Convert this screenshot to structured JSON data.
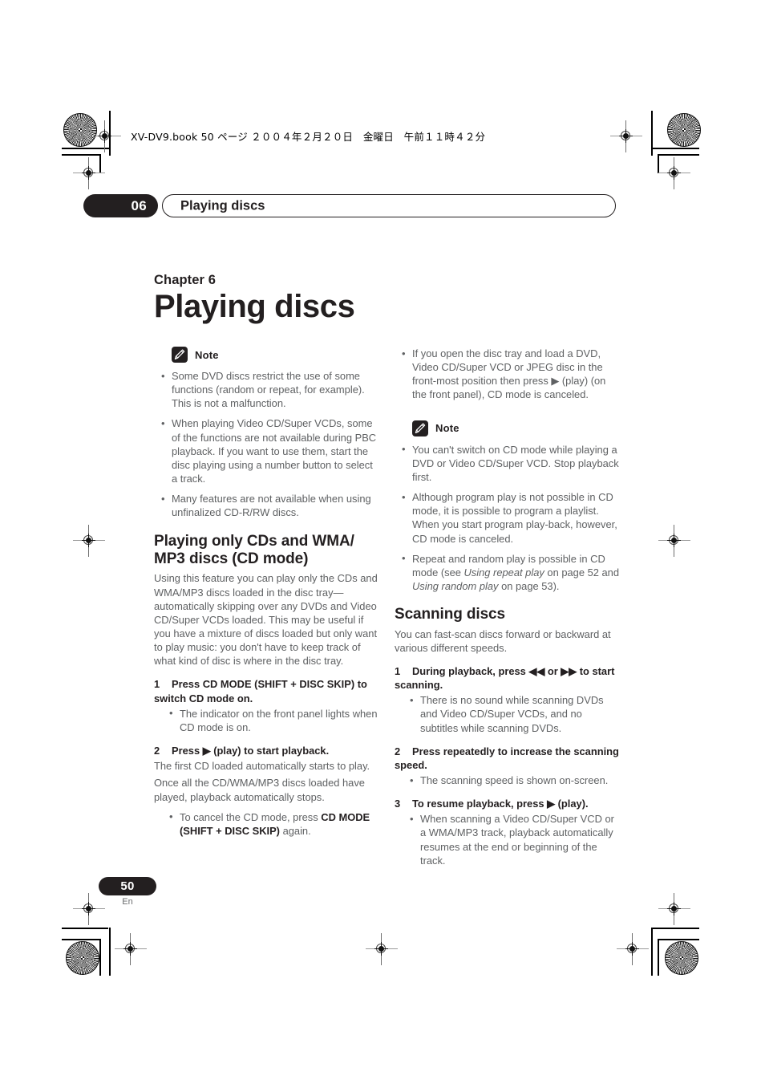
{
  "print_marks": {
    "book_stamp": "XV-DV9.book 50 ページ  ２００４年２月２０日　金曜日　午前１１時４２分"
  },
  "running_head": {
    "chapter_number": "06",
    "chapter_name": "Playing discs"
  },
  "title_block": {
    "chapter_label": "Chapter 6",
    "chapter_title": "Playing discs"
  },
  "left_column": {
    "note_label": "Note",
    "note_icon": "pencil-icon",
    "note_bullets": [
      "Some DVD discs restrict the use of some functions (random or repeat, for example). This is not a malfunction.",
      "When playing Video CD/Super VCDs, some of the functions are not available during PBC playback. If you want to use them, start the disc playing using a number button to select a track.",
      "Many features are not available when using unfinalized CD-R/RW discs."
    ],
    "section_heading": "Playing only CDs and WMA/ MP3 discs (CD mode)",
    "section_intro": "Using this feature you can play only the CDs and WMA/MP3 discs loaded in the disc tray—automatically skipping over any DVDs and Video CD/Super VCDs loaded. This may be useful if you have a mixture of discs loaded but only want to play music: you don't have to keep track of what kind of disc is where in the disc tray.",
    "step1_num": "1",
    "step1_text": "Press CD MODE (SHIFT + DISC SKIP) to switch CD mode on.",
    "step1_bullets": [
      "The indicator on the front panel lights when CD mode is on."
    ],
    "step2_num": "2",
    "step2_text": "Press ▶ (play) to start playback.",
    "step2_body_1": "The first CD loaded automatically starts to play.",
    "step2_body_2": "Once all the CD/WMA/MP3 discs loaded have played, playback automatically stops.",
    "step2_bullet_prefix": "To cancel the CD mode, press ",
    "step2_bullet_bold": "CD MODE (SHIFT + DISC SKIP)",
    "step2_bullet_suffix": " again."
  },
  "right_column": {
    "top_bullets": [
      "If you open the disc tray and load a DVD, Video CD/Super VCD or JPEG disc in the front-most position then press ▶ (play) (on the front panel), CD mode is canceled."
    ],
    "note_label": "Note",
    "note_icon": "pencil-icon",
    "note_bullet_1": "You can't switch on CD mode while playing a DVD or Video CD/Super VCD. Stop playback first.",
    "note_bullet_2": "Although program play is not possible in CD mode, it is possible to program a playlist. When you start program play-back, however, CD mode is canceled.",
    "note_bullet_3_pre": "Repeat and random play is possible in CD mode (see ",
    "note_bullet_3_it1": "Using repeat play",
    "note_bullet_3_mid": " on page 52 and ",
    "note_bullet_3_it2": "Using random play",
    "note_bullet_3_post": " on page 53).",
    "section_heading": "Scanning discs",
    "section_intro": "You can fast-scan discs forward or backward at various different speeds.",
    "step1_num": "1",
    "step1_text": "During playback, press ◀◀ or ▶▶ to start scanning.",
    "step1_bullets": [
      "There is no sound while scanning DVDs and Video CD/Super VCDs, and no subtitles while scanning DVDs."
    ],
    "step2_num": "2",
    "step2_text": "Press repeatedly to increase the scanning speed.",
    "step2_bullets": [
      "The scanning speed is shown on-screen."
    ],
    "step3_num": "3",
    "step3_text": "To resume playback, press ▶ (play).",
    "step3_bullets": [
      "When scanning a Video CD/Super VCD or a WMA/MP3 track, playback automatically resumes at the end or beginning of the track."
    ]
  },
  "footer": {
    "page_number": "50",
    "language_code": "En"
  },
  "colors": {
    "ink_black": "#231f20",
    "body_gray": "#5f6163"
  }
}
